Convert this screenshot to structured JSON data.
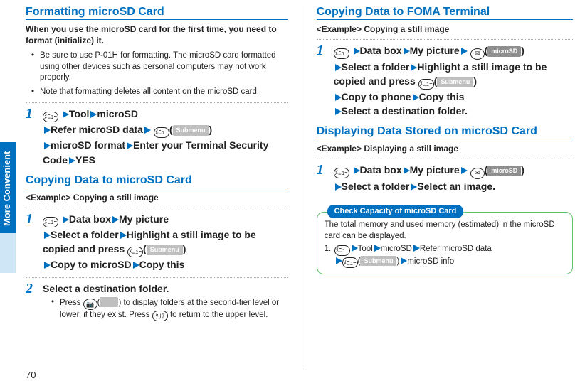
{
  "sidebar": {
    "label": "More Convenient"
  },
  "page_number": "70",
  "col1": {
    "sec1": {
      "title": "Formatting microSD Card",
      "intro": "When you use the microSD card for the first time, you need to format (initialize) it.",
      "bullets": [
        "Be sure to use P-01H for formatting. The microSD card formatted using other devices such as personal computers may not work properly.",
        "Note that formatting deletes all content on the microSD card."
      ],
      "step1": {
        "num": "1",
        "key1": "ﾒﾆｭｰ",
        "p1a": "Tool",
        "p1b": "microSD",
        "p2a": "Refer microSD data",
        "key2": "ﾒﾆｭｰ",
        "soft2": "Submenu",
        "p3a": "microSD format",
        "p3b": "Enter your Terminal Security Code",
        "p3c": "YES"
      }
    },
    "sec2": {
      "title": "Copying Data to microSD Card",
      "example": "<Example> Copying a still image",
      "step1": {
        "num": "1",
        "key1": "ﾒﾆｭｰ",
        "p1a": "Data box",
        "p1b": "My picture",
        "p2a": "Select a folder",
        "p2b": "Highlight a still image to be copied and press ",
        "key2": "ﾒﾆｭｰ",
        "soft2": "Submenu",
        "p3a": "Copy to microSD",
        "p3b": "Copy this"
      },
      "step2": {
        "num": "2",
        "title": "Select a destination folder.",
        "note_a": "Press ",
        "k_cam": "📷",
        "soft_cam": "",
        "note_b": " to display folders at the second-tier level or lower, if they exist. Press ",
        "k_clr": "ｸﾘｱ",
        "note_c": " to return to the upper level."
      }
    }
  },
  "col2": {
    "sec1": {
      "title": "Copying Data to FOMA Terminal",
      "example": "<Example> Copying a still image",
      "step1": {
        "num": "1",
        "key1": "ﾒﾆｭｰ",
        "p1a": "Data box",
        "p1b": "My picture",
        "soft_mail": "microSD",
        "p2a": "Select a folder",
        "p2b": "Highlight a still image to be copied and press ",
        "key2": "ﾒﾆｭｰ",
        "soft2": "Submenu",
        "p3a": "Copy to phone",
        "p3b": "Copy this",
        "p4a": "Select a destination folder."
      }
    },
    "sec2": {
      "title": "Displaying Data Stored on microSD Card",
      "example": "<Example> Displaying a still image",
      "step1": {
        "num": "1",
        "key1": "ﾒﾆｭｰ",
        "p1a": "Data box",
        "p1b": "My picture",
        "soft_mail": "microSD",
        "p2a": "Select a folder",
        "p2b": "Select an image."
      }
    },
    "infobox": {
      "label": "Check Capacity of microSD Card",
      "text": "The total memory and used memory (estimated) in the microSD card can be displayed.",
      "step_num": "1.",
      "k1": "ﾒﾆｭｰ",
      "p1": "Tool",
      "p2": "microSD",
      "p3": "Refer microSD data",
      "k2": "ﾒﾆｭｰ",
      "soft2": "Submenu",
      "p4": "microSD info"
    }
  }
}
